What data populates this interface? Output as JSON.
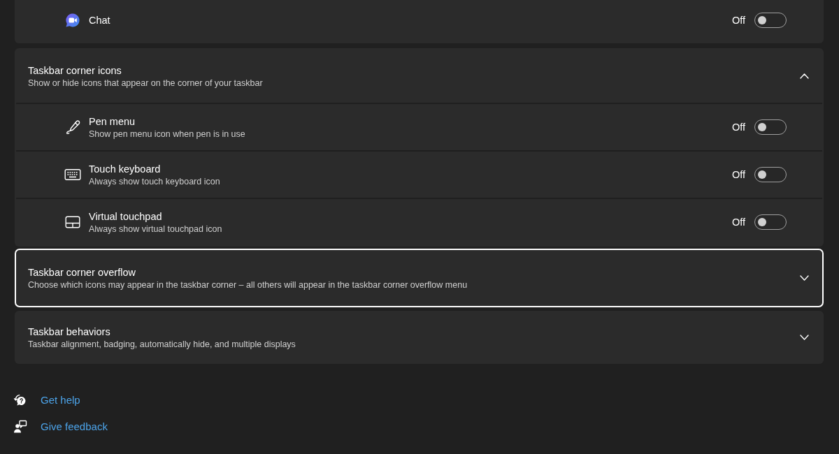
{
  "cards": [
    {
      "focused": false,
      "items": [
        {
          "label": "Chat",
          "state_label": "Off",
          "on": false
        }
      ]
    },
    {
      "title": "Taskbar corner icons",
      "subtitle": "Show or hide icons that appear on the corner of your taskbar",
      "expanded": true,
      "focused": false,
      "items": [
        {
          "label": "Pen menu",
          "description": "Show pen menu icon when pen is in use",
          "state_label": "Off",
          "on": false
        },
        {
          "label": "Touch keyboard",
          "description": "Always show touch keyboard icon",
          "state_label": "Off",
          "on": false
        },
        {
          "label": "Virtual touchpad",
          "description": "Always show virtual touchpad icon",
          "state_label": "Off",
          "on": false
        }
      ]
    },
    {
      "title": "Taskbar corner overflow",
      "subtitle": "Choose which icons may appear in the taskbar corner – all others will appear in the taskbar corner overflow menu",
      "expanded": false,
      "focused": true
    },
    {
      "title": "Taskbar behaviors",
      "subtitle": "Taskbar alignment, badging, automatically hide, and multiple displays",
      "expanded": false,
      "focused": false
    }
  ],
  "help_links": [
    {
      "label": "Get help"
    },
    {
      "label": "Give feedback"
    }
  ]
}
